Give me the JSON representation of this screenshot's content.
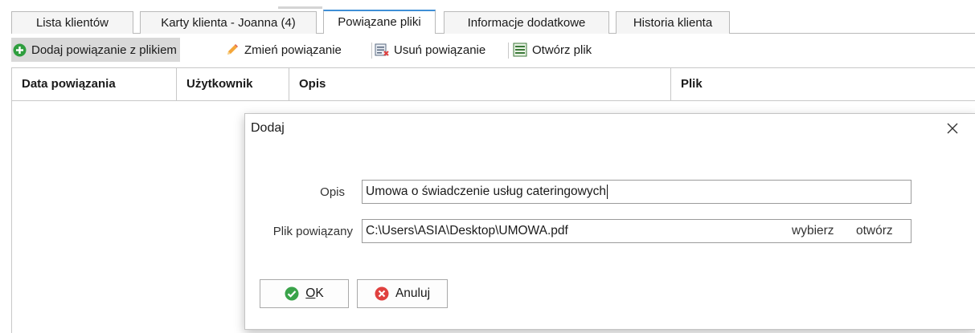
{
  "tabs": [
    {
      "label": "Lista klientów",
      "active": false
    },
    {
      "label": "Karty klienta - Joanna (4)",
      "active": false
    },
    {
      "label": "Powiązane pliki",
      "active": true
    },
    {
      "label": "Informacje dodatkowe",
      "active": false
    },
    {
      "label": "Historia klienta",
      "active": false
    }
  ],
  "toolbar": {
    "add_label": "Dodaj powiązanie z plikiem",
    "edit_label": "Zmień powiązanie",
    "delete_label": "Usuń powiązanie",
    "open_label": "Otwórz plik"
  },
  "grid": {
    "columns": [
      "Data powiązania",
      "Użytkownik",
      "Opis",
      "Plik"
    ],
    "rows": []
  },
  "dialog": {
    "title": "Dodaj",
    "desc_label": "Opis",
    "desc_value": "Umowa o świadczenie usług cateringowych",
    "file_label": "Plik powiązany",
    "file_value": "C:\\Users\\ASIA\\Desktop\\UMOWA.pdf",
    "choose_link": "wybierz",
    "open_link": "otwórz",
    "ok_label_underlined": "O",
    "ok_label_rest": "K",
    "cancel_label": "Anuluj"
  },
  "colors": {
    "active_tab_accent": "#3f8fd6",
    "add_icon": "#2e9e3e",
    "ok_icon": "#3aa34a",
    "cancel_icon": "#e0413f"
  },
  "icons": [
    "plus-circle-icon",
    "pencil-icon",
    "delete-list-icon",
    "open-file-icon",
    "close-icon",
    "check-circle-icon",
    "x-circle-icon"
  ]
}
